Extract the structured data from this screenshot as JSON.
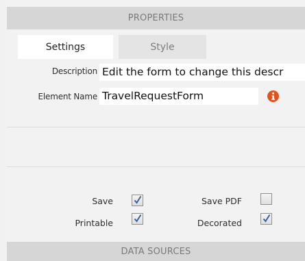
{
  "headers": {
    "properties": "PROPERTIES",
    "data_sources": "DATA SOURCES"
  },
  "tabs": [
    {
      "label": "Settings",
      "active": true
    },
    {
      "label": "Style",
      "active": false
    }
  ],
  "fields": {
    "description": {
      "label": "Description",
      "value": "Edit the form to change this descr"
    },
    "element_name": {
      "label": "Element Name",
      "value": "TravelRequestForm"
    }
  },
  "info_icon": {
    "name": "info-icon",
    "color": "#e0531f"
  },
  "options": [
    {
      "label": "Save",
      "checked": true
    },
    {
      "label": "Save PDF",
      "checked": false
    },
    {
      "label": "Printable",
      "checked": true
    },
    {
      "label": "Decorated",
      "checked": true
    }
  ],
  "colors": {
    "header_bg": "#d6d6d6",
    "check_accent": "#3a5f99"
  }
}
